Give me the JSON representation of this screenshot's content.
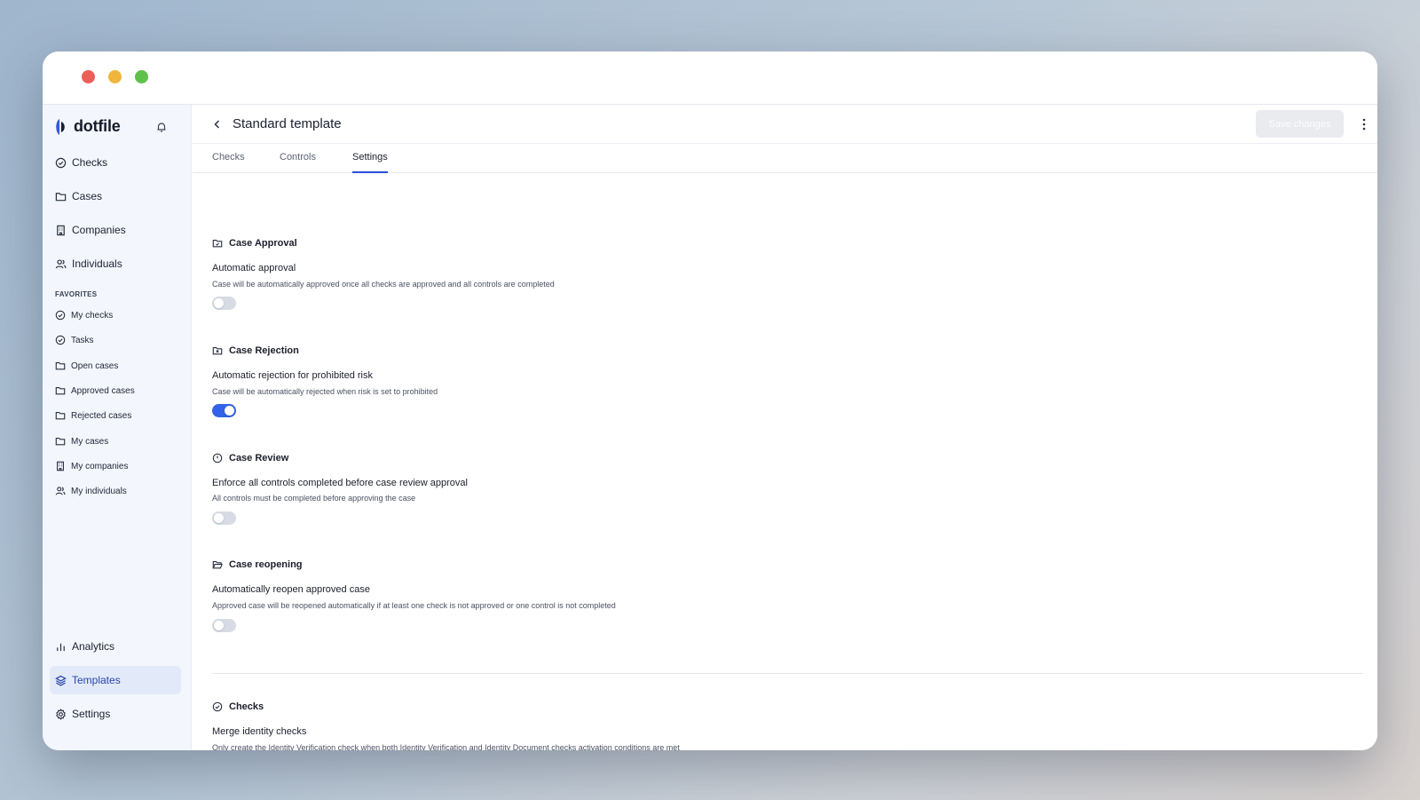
{
  "app": {
    "name": "dotfile"
  },
  "sidebar": {
    "nav": [
      {
        "label": "Checks",
        "icon": "check-circle-icon"
      },
      {
        "label": "Cases",
        "icon": "folder-icon"
      },
      {
        "label": "Companies",
        "icon": "building-icon"
      },
      {
        "label": "Individuals",
        "icon": "users-icon"
      }
    ],
    "favorites_label": "FAVORITES",
    "favorites": [
      {
        "label": "My checks",
        "icon": "check-circle-icon"
      },
      {
        "label": "Tasks",
        "icon": "check-circle-icon"
      },
      {
        "label": "Open cases",
        "icon": "folder-icon"
      },
      {
        "label": "Approved cases",
        "icon": "folder-icon"
      },
      {
        "label": "Rejected cases",
        "icon": "folder-icon"
      },
      {
        "label": "My cases",
        "icon": "folder-icon"
      },
      {
        "label": "My companies",
        "icon": "building-icon"
      },
      {
        "label": "My individuals",
        "icon": "users-icon"
      }
    ],
    "bottom": [
      {
        "label": "Analytics",
        "icon": "bar-chart-icon"
      },
      {
        "label": "Templates",
        "icon": "layers-icon",
        "active": true
      },
      {
        "label": "Settings",
        "icon": "gear-icon"
      }
    ]
  },
  "header": {
    "title": "Standard template",
    "save_label": "Save changes"
  },
  "tabs": [
    {
      "label": "Checks"
    },
    {
      "label": "Controls"
    },
    {
      "label": "Settings",
      "active": true
    }
  ],
  "sections": [
    {
      "title": "Case Approval",
      "label": "Automatic approval",
      "description": "Case will be automatically approved once all checks are approved and all controls are completed",
      "enabled": false
    },
    {
      "title": "Case Rejection",
      "label": "Automatic rejection for prohibited risk",
      "description": "Case will be automatically rejected when risk is set to prohibited",
      "enabled": true
    },
    {
      "title": "Case Review",
      "label": "Enforce all controls completed before case review approval",
      "description": "All controls must be completed before approving the case",
      "enabled": false
    },
    {
      "title": "Case reopening",
      "label": "Automatically reopen approved case",
      "description": "Approved case will be reopened automatically if at least one check is not approved or one control is not completed",
      "enabled": false
    },
    {
      "title": "Checks",
      "label": "Merge identity checks",
      "description": "Only create the Identity Verification check when both Identity Verification and Identity Document checks activation conditions are met",
      "enabled": false
    }
  ],
  "colors": {
    "accent": "#3362e8",
    "active_nav_bg": "#e2eafa",
    "toggle_off": "#d7dbe3"
  }
}
